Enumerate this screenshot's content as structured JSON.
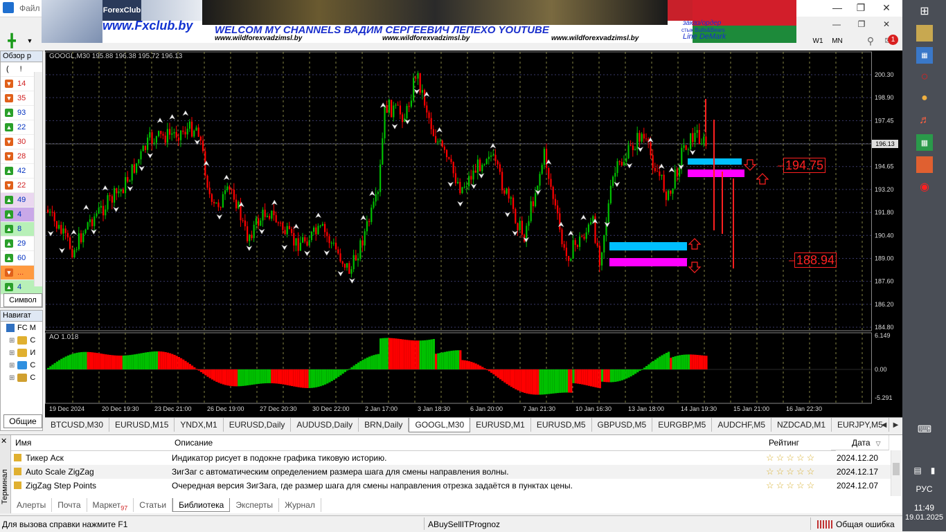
{
  "menu": {
    "file_label": "Файл"
  },
  "banner": {
    "site": "www.Fxclub.by",
    "logo_text": "ForexClub",
    "headline": "WELCOM MY CHANNELS ВАДИМ СЕРГЕЕВИЧ ЛЕПЕХО YOUTUBE",
    "url1": "www.wildforexvadzimsl.by",
    "url2": "www.wildforexvadzimsl.by",
    "url3": "www.wildforexvadzimsl.by",
    "order_text": "заказ/ордер",
    "stick_text": "стык Bulls&Bears",
    "line_text": "Line DeMark"
  },
  "toolbar": {
    "tf_w1": "W1",
    "tf_mn": "MN",
    "alert_count": "1"
  },
  "marketwatch": {
    "title": "Обзор р",
    "head1": "(",
    "head2": "!",
    "rows": [
      {
        "val": "14",
        "dir": "down"
      },
      {
        "val": "35",
        "dir": "down"
      },
      {
        "val": "93",
        "dir": "up"
      },
      {
        "val": "22",
        "dir": "up"
      },
      {
        "val": "30",
        "dir": "down"
      },
      {
        "val": "28",
        "dir": "down"
      },
      {
        "val": "42",
        "dir": "up"
      },
      {
        "val": "22",
        "dir": "down"
      },
      {
        "val": "49",
        "dir": "up"
      },
      {
        "val": "4",
        "dir": "up"
      },
      {
        "val": "8",
        "dir": "up"
      },
      {
        "val": "29",
        "dir": "up"
      },
      {
        "val": "60",
        "dir": "up"
      },
      {
        "val": "...",
        "dir": "down"
      },
      {
        "val": "4",
        "dir": "up"
      }
    ],
    "tab_symbols": "Символ"
  },
  "navigator": {
    "title": "Навигат",
    "root": "FC M",
    "items": [
      "С",
      "И",
      "С",
      "С"
    ],
    "tab_common": "Общие"
  },
  "chart": {
    "symbol_label": "GOOGL,M30",
    "ohlc": "195.88 196.38 195.72 196.13",
    "current_price": "196.13",
    "level_high": "194.75",
    "level_low": "188.94",
    "ao_label": "AO 1.018",
    "price_ticks": [
      "200.30",
      "198.90",
      "197.45",
      "196.05",
      "194.65",
      "193.20",
      "191.80",
      "190.40",
      "189.00",
      "187.60",
      "186.20",
      "184.80"
    ],
    "ao_ticks": [
      "6.149",
      "0.00",
      "-5.291"
    ],
    "time_labels": [
      "19 Dec 2024",
      "20 Dec 19:30",
      "23 Dec 21:00",
      "26 Dec 19:00",
      "27 Dec 20:30",
      "30 Dec 22:00",
      "2 Jan 17:00",
      "3 Jan 18:30",
      "6 Jan 20:00",
      "7 Jan 21:30",
      "10 Jan 16:30",
      "13 Jan 18:00",
      "14 Jan 19:30",
      "15 Jan 21:00",
      "16 Jan 22:30"
    ],
    "colors": {
      "bull": "#00c000",
      "bear": "#ff0000",
      "grid": "#3a3a6a",
      "cyan": "#00bfff",
      "magenta": "#ff00ff"
    }
  },
  "chart_tabs": [
    "BTCUSD,M30",
    "EURUSD,M15",
    "YNDX,M1",
    "EURUSD,Daily",
    "AUDUSD,Daily",
    "BRN,Daily",
    "GOOGL,M30",
    "EURUSD,M1",
    "EURUSD,M5",
    "GBPUSD,M5",
    "EURGBP,M5",
    "AUDCHF,M5",
    "NZDCAD,M1",
    "EURJPY,M5"
  ],
  "active_chart_tab": "GOOGL,M30",
  "terminal": {
    "side_label": "Терминал",
    "col_name": "Имя",
    "col_desc": "Описание",
    "col_rating": "Рейтинг",
    "col_date": "Дата",
    "rows": [
      {
        "name": "Тикер Аск",
        "desc": "Индикатор рисует в подокне графика тиковую историю.",
        "date": "2024.12.20"
      },
      {
        "name": "Auto Scale ZigZag",
        "desc": "ЗигЗаг с автоматическим определением размера шага для смены направления волны.",
        "date": "2024.12.17"
      },
      {
        "name": "ZigZag Step Points",
        "desc": "Очередная версия ЗигЗага, где размер шага для смены направления отрезка задаётся в пунктах цены.",
        "date": "2024.12.07"
      }
    ],
    "tabs": [
      {
        "label": "Алерты"
      },
      {
        "label": "Почта"
      },
      {
        "label": "Маркет",
        "badge": "97"
      },
      {
        "label": "Статьи"
      },
      {
        "label": "Библиотека"
      },
      {
        "label": "Эксперты"
      },
      {
        "label": "Журнал"
      }
    ],
    "active_tab": "Библиотека"
  },
  "status": {
    "help": "Для вызова справки нажмите F1",
    "profile": "ABuySellITPrognoz",
    "error": "Общая ошибка"
  },
  "taskbar": {
    "lang": "РУС",
    "time": "11:49",
    "date": "19.01.2025"
  }
}
